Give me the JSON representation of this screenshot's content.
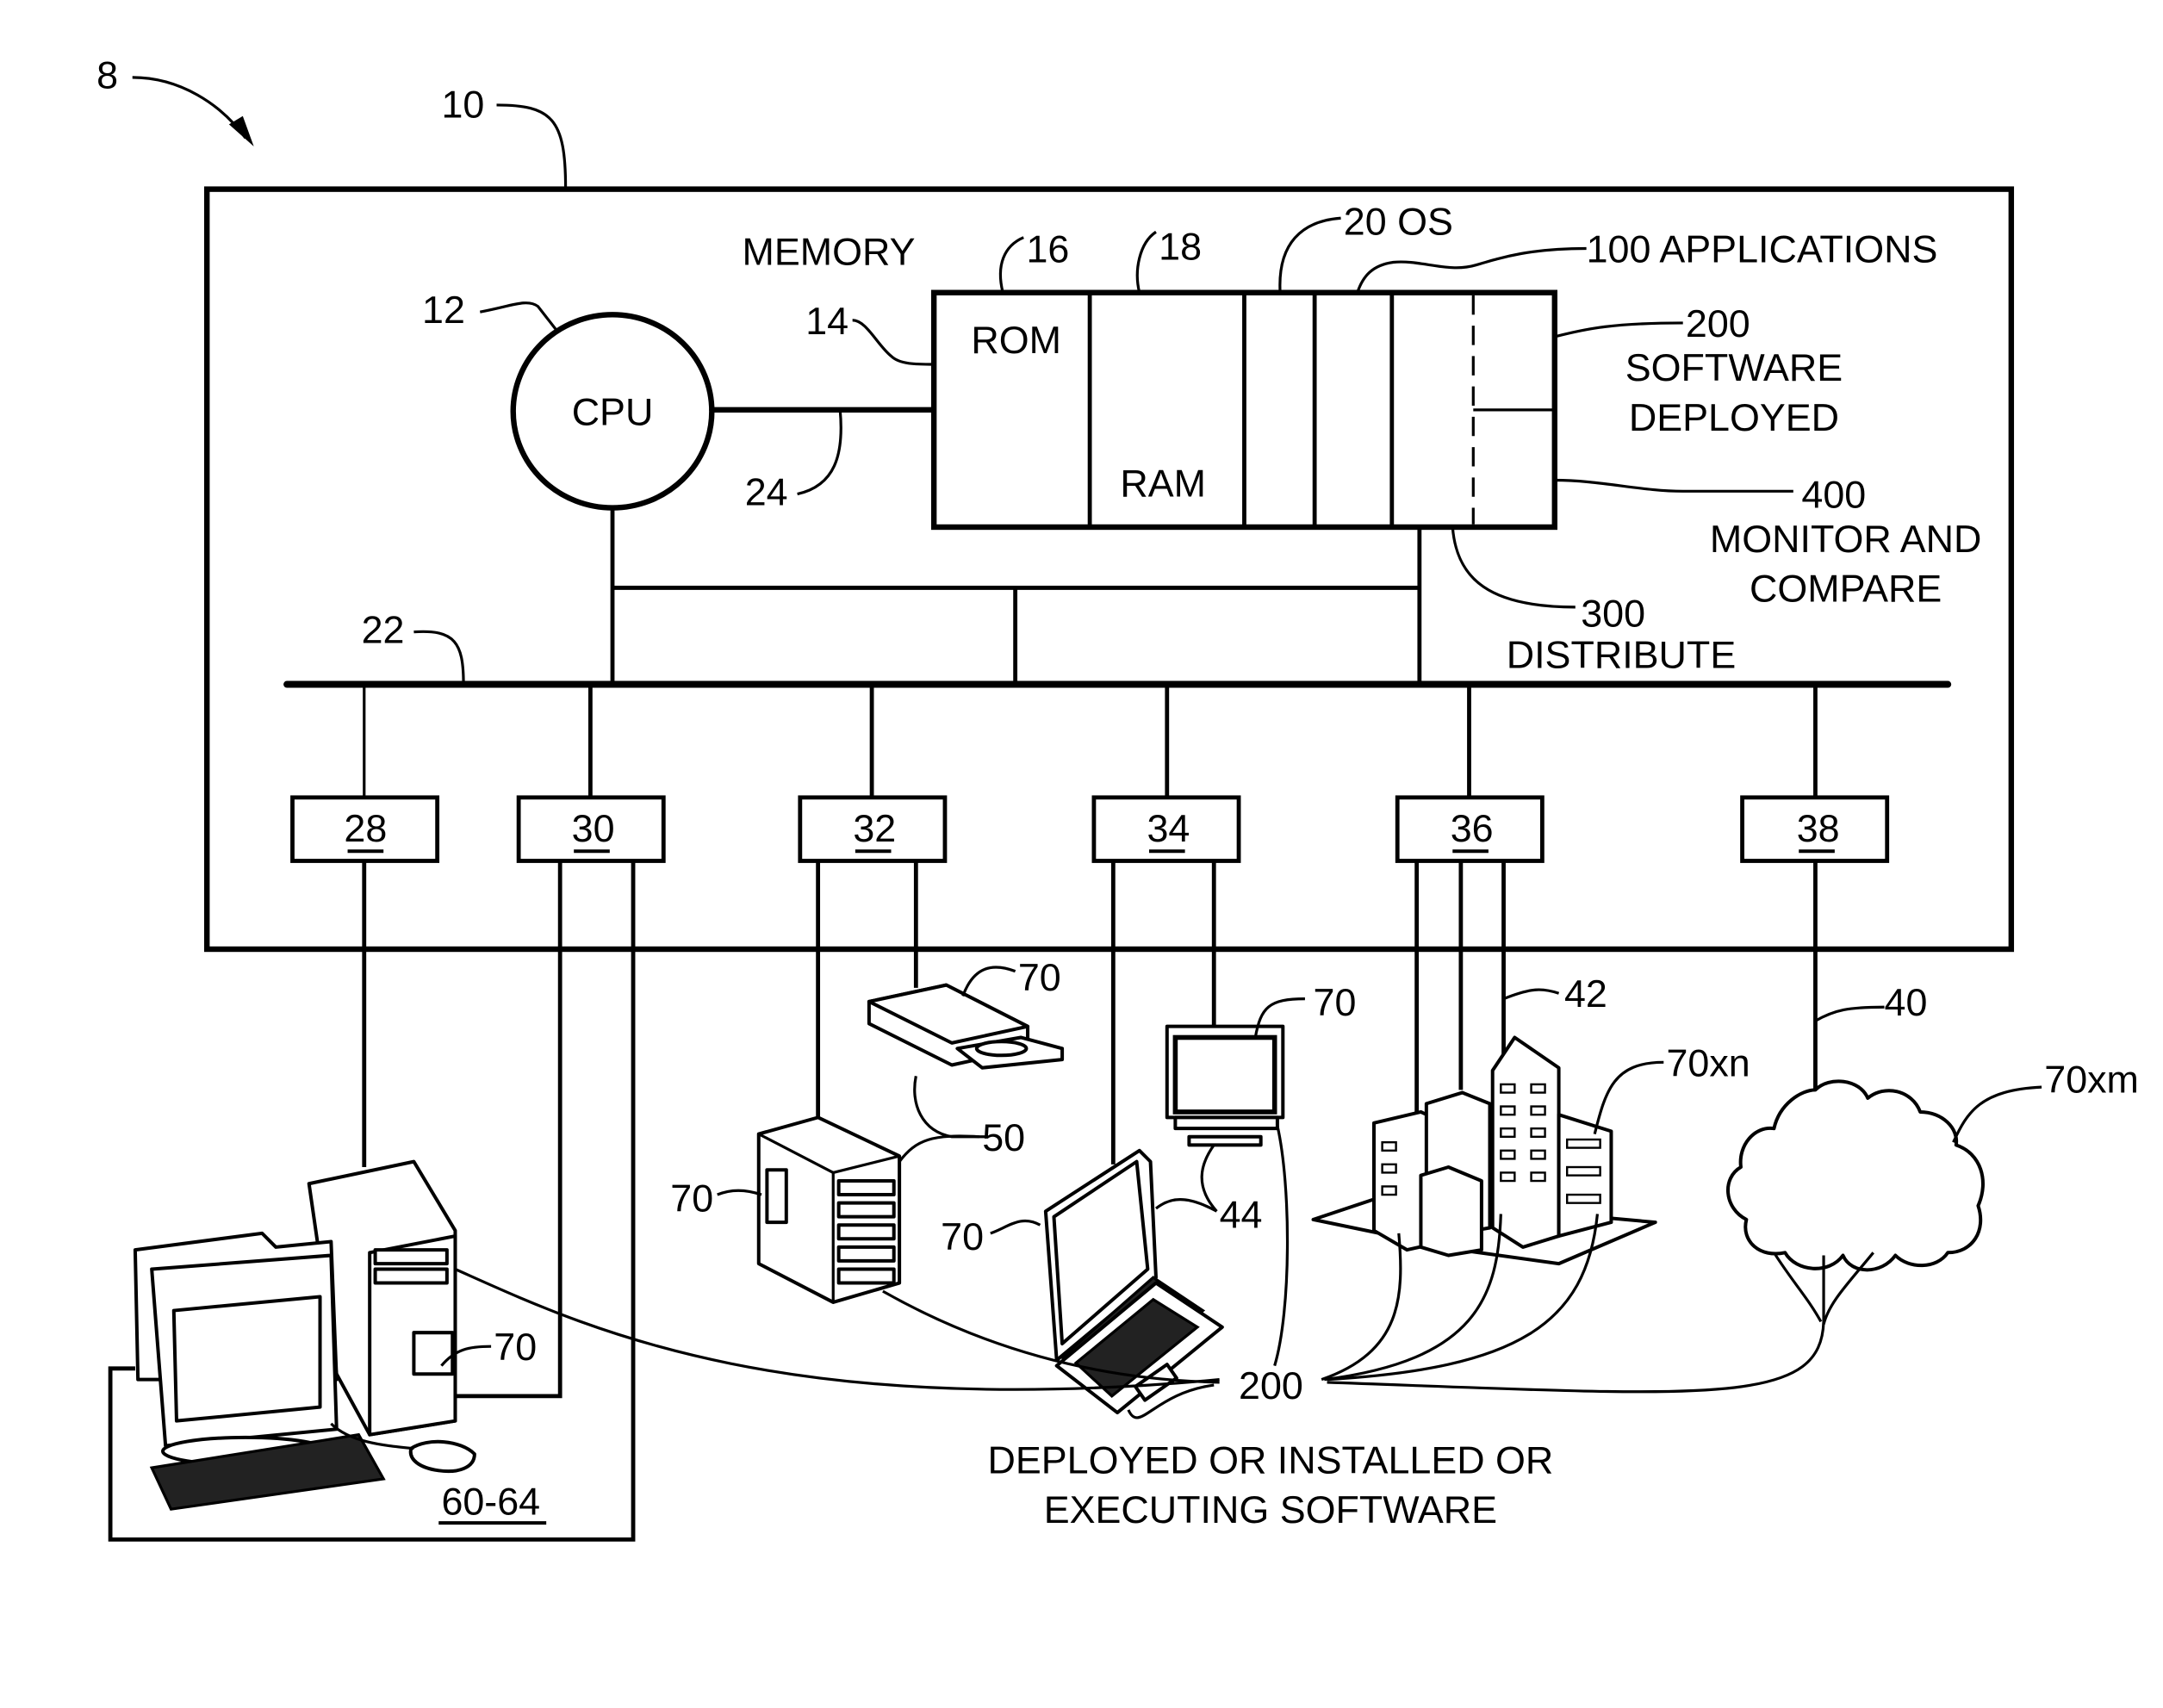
{
  "figure": {
    "system_ref": "8",
    "computer_ref": "10",
    "cpu": {
      "ref": "12",
      "label": "CPU"
    },
    "memory": {
      "title": "MEMORY",
      "ref": "14",
      "rom": {
        "ref": "16",
        "label": "ROM"
      },
      "ram": {
        "ref": "18",
        "label": "RAM"
      },
      "os": {
        "label": "20 OS"
      },
      "applications": {
        "label": "100 APPLICATIONS"
      },
      "software_deployed": {
        "ref": "200",
        "line1": "SOFTWARE",
        "line2": "DEPLOYED"
      },
      "monitor_compare": {
        "ref": "400",
        "line1": "MONITOR AND",
        "line2": "COMPARE"
      },
      "distribute": {
        "ref": "300",
        "line1": "DISTRIBUTE"
      }
    },
    "bus": {
      "system_bus_ref": "22",
      "memory_bus_ref": "24"
    },
    "interfaces": [
      "28",
      "30",
      "32",
      "34",
      "36",
      "38"
    ],
    "devices": {
      "workstation": {
        "ref": "60-64",
        "software_ref": "70"
      },
      "storage_drive": {
        "software_ref": "70"
      },
      "server": {
        "ref": "50",
        "software_ref": "70"
      },
      "laptop": {
        "software_ref": "70"
      },
      "monitor": {
        "ref": "44",
        "software_ref": "70"
      },
      "enterprise": {
        "ref": "42",
        "software_ref": "70xn"
      },
      "cloud": {
        "ref": "40",
        "software_ref": "70xm"
      }
    },
    "software_ref": "200",
    "caption_line1": "DEPLOYED OR INSTALLED OR",
    "caption_line2": "EXECUTING SOFTWARE"
  }
}
